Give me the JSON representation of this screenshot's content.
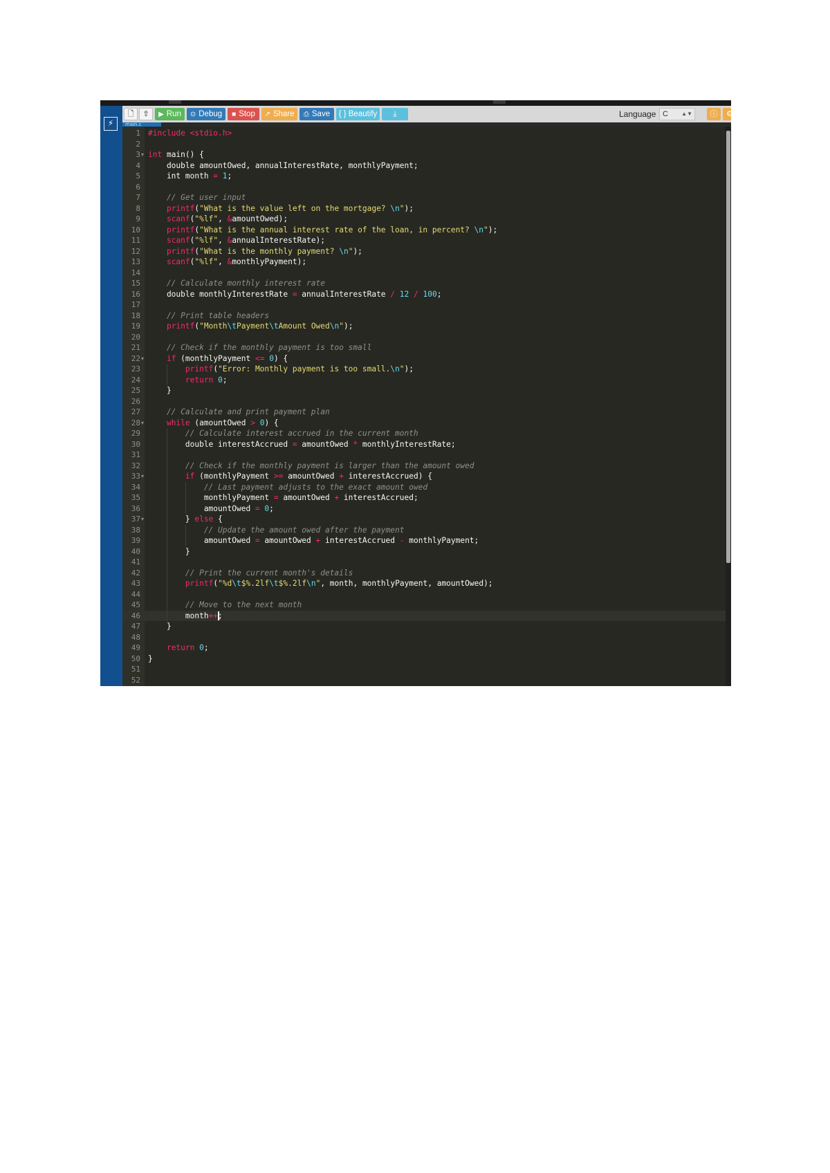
{
  "toolbar": {
    "buttons": [
      {
        "label": "Run",
        "color": "#5cb85c",
        "glyph": "▶"
      },
      {
        "label": "Debug",
        "color": "#337ab7",
        "glyph": "⊙"
      },
      {
        "label": "Stop",
        "color": "#d9534f",
        "glyph": "■"
      },
      {
        "label": "Share",
        "color": "#f0ad4e",
        "glyph": "↗"
      },
      {
        "label": "Save",
        "color": "#337ab7",
        "glyph": "⎙"
      },
      {
        "label": "{ } Beautify",
        "color": "#5bc0de",
        "glyph": ""
      }
    ],
    "language_label": "Language",
    "language_value": "C",
    "icons": [
      "new-file-icon",
      "upload-icon",
      "download-icon",
      "info-icon",
      "settings-icon"
    ]
  },
  "tab": {
    "label": "main.c"
  },
  "editor": {
    "lines": [
      [
        [
          "#include <stdio.h>",
          "pp"
        ]
      ],
      [],
      [
        [
          "int",
          "k"
        ],
        [
          " main() {",
          ""
        ]
      ],
      [
        [
          "    double amountOwed, annualInterestRate, monthlyPayment;",
          ""
        ]
      ],
      [
        [
          "    int month ",
          ""
        ],
        [
          "=",
          "o"
        ],
        [
          " ",
          ""
        ],
        [
          "1",
          "n"
        ],
        [
          ";",
          ""
        ]
      ],
      [],
      [
        [
          "    // Get user input",
          "c"
        ]
      ],
      [
        [
          "    ",
          ""
        ],
        [
          "printf",
          "f"
        ],
        [
          "(",
          ""
        ],
        [
          "\"What is the value left on the mortgage? ",
          "s"
        ],
        [
          "\\n",
          "n"
        ],
        [
          "\"",
          "s"
        ],
        [
          ");",
          ""
        ]
      ],
      [
        [
          "    ",
          ""
        ],
        [
          "scanf",
          "f"
        ],
        [
          "(",
          ""
        ],
        [
          "\"%lf\"",
          "s"
        ],
        [
          ", ",
          ""
        ],
        [
          "&",
          "o"
        ],
        [
          "amountOwed);",
          ""
        ]
      ],
      [
        [
          "    ",
          ""
        ],
        [
          "printf",
          "f"
        ],
        [
          "(",
          ""
        ],
        [
          "\"What is the annual interest rate of the loan, in percent? ",
          "s"
        ],
        [
          "\\n",
          "n"
        ],
        [
          "\"",
          "s"
        ],
        [
          ");",
          ""
        ]
      ],
      [
        [
          "    ",
          ""
        ],
        [
          "scanf",
          "f"
        ],
        [
          "(",
          ""
        ],
        [
          "\"%lf\"",
          "s"
        ],
        [
          ", ",
          ""
        ],
        [
          "&",
          "o"
        ],
        [
          "annualInterestRate);",
          ""
        ]
      ],
      [
        [
          "    ",
          ""
        ],
        [
          "printf",
          "f"
        ],
        [
          "(",
          ""
        ],
        [
          "\"What is the monthly payment? ",
          "s"
        ],
        [
          "\\n",
          "n"
        ],
        [
          "\"",
          "s"
        ],
        [
          ");",
          ""
        ]
      ],
      [
        [
          "    ",
          ""
        ],
        [
          "scanf",
          "f"
        ],
        [
          "(",
          ""
        ],
        [
          "\"%lf\"",
          "s"
        ],
        [
          ", ",
          ""
        ],
        [
          "&",
          "o"
        ],
        [
          "monthlyPayment);",
          ""
        ]
      ],
      [],
      [
        [
          "    // Calculate monthly interest rate",
          "c"
        ]
      ],
      [
        [
          "    double monthlyInterestRate ",
          ""
        ],
        [
          "=",
          "o"
        ],
        [
          " annualInterestRate ",
          ""
        ],
        [
          "/",
          "o"
        ],
        [
          " ",
          ""
        ],
        [
          "12",
          "n"
        ],
        [
          " ",
          ""
        ],
        [
          "/",
          "o"
        ],
        [
          " ",
          ""
        ],
        [
          "100",
          "n"
        ],
        [
          ";",
          ""
        ]
      ],
      [],
      [
        [
          "    // Print table headers",
          "c"
        ]
      ],
      [
        [
          "    ",
          ""
        ],
        [
          "printf",
          "f"
        ],
        [
          "(",
          ""
        ],
        [
          "\"Month",
          "s"
        ],
        [
          "\\t",
          "n"
        ],
        [
          "Payment",
          "s"
        ],
        [
          "\\t",
          "n"
        ],
        [
          "Amount Owed",
          "s"
        ],
        [
          "\\n",
          "n"
        ],
        [
          "\"",
          "s"
        ],
        [
          ");",
          ""
        ]
      ],
      [],
      [
        [
          "    // Check if the monthly payment is too small",
          "c"
        ]
      ],
      [
        [
          "    ",
          ""
        ],
        [
          "if",
          "k"
        ],
        [
          " (monthlyPayment ",
          ""
        ],
        [
          "<=",
          "o"
        ],
        [
          " ",
          ""
        ],
        [
          "0",
          "n"
        ],
        [
          ") {",
          ""
        ]
      ],
      [
        [
          "        ",
          ""
        ],
        [
          "printf",
          "f"
        ],
        [
          "(",
          ""
        ],
        [
          "\"Error: Monthly payment is too small.",
          "s"
        ],
        [
          "\\n",
          "n"
        ],
        [
          "\"",
          "s"
        ],
        [
          ");",
          ""
        ]
      ],
      [
        [
          "        ",
          ""
        ],
        [
          "return",
          "k"
        ],
        [
          " ",
          ""
        ],
        [
          "0",
          "n"
        ],
        [
          ";",
          ""
        ]
      ],
      [
        [
          "    }",
          ""
        ]
      ],
      [],
      [
        [
          "    // Calculate and print payment plan",
          "c"
        ]
      ],
      [
        [
          "    ",
          ""
        ],
        [
          "while",
          "k"
        ],
        [
          " (amountOwed ",
          ""
        ],
        [
          ">",
          "o"
        ],
        [
          " ",
          ""
        ],
        [
          "0",
          "n"
        ],
        [
          ") {",
          ""
        ]
      ],
      [
        [
          "        // Calculate interest accrued in the current month",
          "c"
        ]
      ],
      [
        [
          "        double interestAccrued ",
          ""
        ],
        [
          "=",
          "o"
        ],
        [
          " amountOwed ",
          ""
        ],
        [
          "*",
          "o"
        ],
        [
          " monthlyInterestRate;",
          ""
        ]
      ],
      [],
      [
        [
          "        // Check if the monthly payment is larger than the amount owed",
          "c"
        ]
      ],
      [
        [
          "        ",
          ""
        ],
        [
          "if",
          "k"
        ],
        [
          " (monthlyPayment ",
          ""
        ],
        [
          ">=",
          "o"
        ],
        [
          " amountOwed ",
          ""
        ],
        [
          "+",
          "o"
        ],
        [
          " interestAccrued) {",
          ""
        ]
      ],
      [
        [
          "            // Last payment adjusts to the exact amount owed",
          "c"
        ]
      ],
      [
        [
          "            monthlyPayment ",
          ""
        ],
        [
          "=",
          "o"
        ],
        [
          " amountOwed ",
          ""
        ],
        [
          "+",
          "o"
        ],
        [
          " interestAccrued;",
          ""
        ]
      ],
      [
        [
          "            amountOwed ",
          ""
        ],
        [
          "=",
          "o"
        ],
        [
          " ",
          ""
        ],
        [
          "0",
          "n"
        ],
        [
          ";",
          ""
        ]
      ],
      [
        [
          "        } ",
          ""
        ],
        [
          "else",
          "k"
        ],
        [
          " {",
          ""
        ]
      ],
      [
        [
          "            // Update the amount owed after the payment",
          "c"
        ]
      ],
      [
        [
          "            amountOwed ",
          ""
        ],
        [
          "=",
          "o"
        ],
        [
          " amountOwed ",
          ""
        ],
        [
          "+",
          "o"
        ],
        [
          " interestAccrued ",
          ""
        ],
        [
          "-",
          "o"
        ],
        [
          " monthlyPayment;",
          ""
        ]
      ],
      [
        [
          "        }",
          ""
        ]
      ],
      [],
      [
        [
          "        // Print the current month's details",
          "c"
        ]
      ],
      [
        [
          "        ",
          ""
        ],
        [
          "printf",
          "f"
        ],
        [
          "(",
          ""
        ],
        [
          "\"%d",
          "s"
        ],
        [
          "\\t",
          "n"
        ],
        [
          "$%.2lf",
          "s"
        ],
        [
          "\\t",
          "n"
        ],
        [
          "$%.2lf",
          "s"
        ],
        [
          "\\n",
          "n"
        ],
        [
          "\"",
          "s"
        ],
        [
          ", month, monthlyPayment, amountOwed);",
          ""
        ]
      ],
      [],
      [
        [
          "        // Move to the next month",
          "c"
        ]
      ],
      [
        [
          "        month",
          ""
        ],
        [
          "++",
          "o"
        ],
        [
          ";",
          ""
        ]
      ],
      [
        [
          "    }",
          ""
        ]
      ],
      [],
      [
        [
          "    ",
          ""
        ],
        [
          "return",
          "k"
        ],
        [
          " ",
          ""
        ],
        [
          "0",
          "n"
        ],
        [
          ";",
          ""
        ]
      ],
      [
        [
          "}",
          ""
        ]
      ],
      [],
      []
    ],
    "fold_lines": [
      3,
      22,
      28,
      33,
      37
    ],
    "active_line": 46,
    "colors": {
      "k": "#f92672",
      "pp": "#f92672",
      "f": "#f92672",
      "s": "#e6db74",
      "n": "#66d9ef",
      "o": "#f92672",
      "c": "#8f908a",
      "": "#f8f8f2"
    }
  }
}
